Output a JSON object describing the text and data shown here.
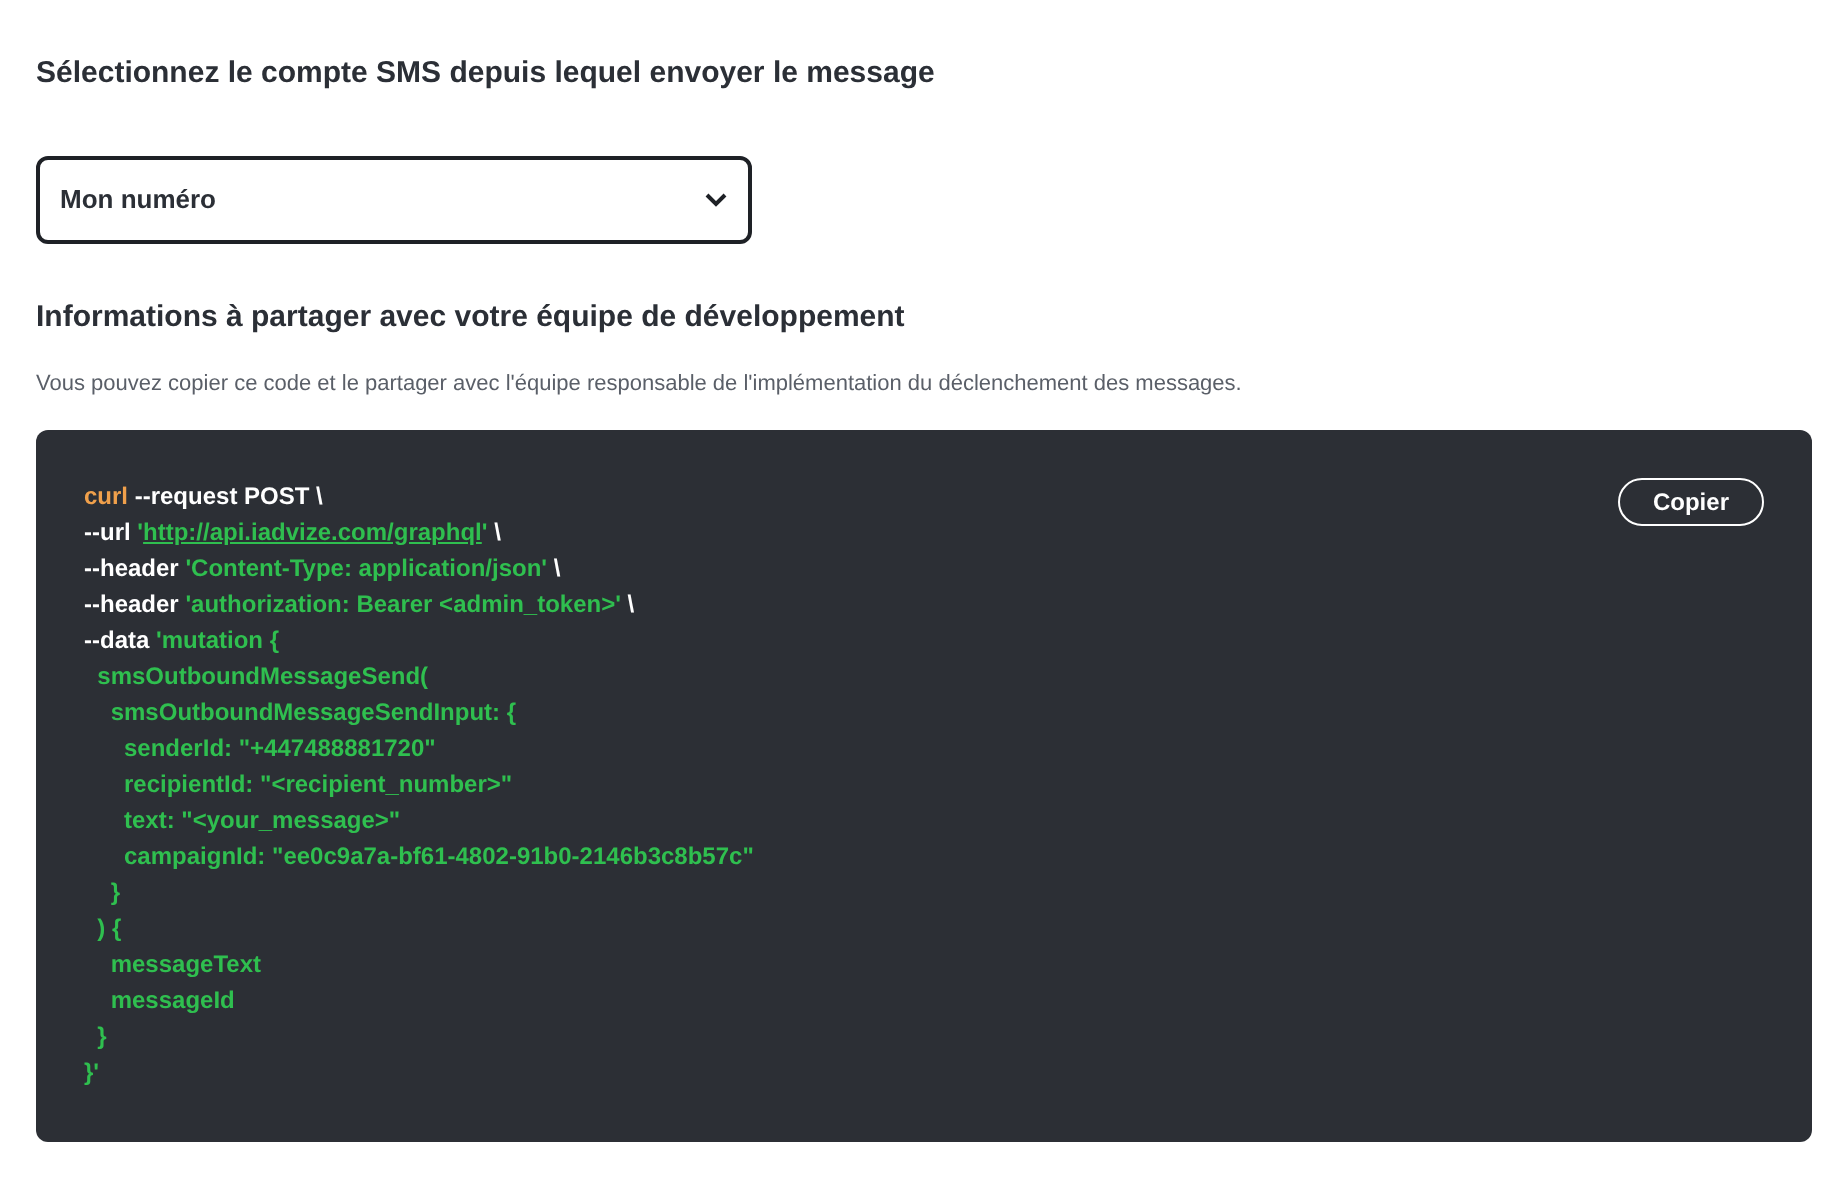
{
  "account_section": {
    "heading": "Sélectionnez le compte SMS depuis lequel envoyer le message",
    "select": {
      "value": "Mon numéro"
    }
  },
  "dev_section": {
    "heading": "Informations à partager avec votre équipe de développement",
    "description": "Vous pouvez copier ce code et le partager avec l'équipe responsable de l'implémentation du déclenchement des messages.",
    "code_block": {
      "copy_button": "Copier",
      "lines": [
        [
          {
            "kind": "keyword",
            "text": "curl"
          },
          {
            "kind": "plain",
            "text": " --request POST \\"
          }
        ],
        [
          {
            "kind": "plain",
            "text": "--url "
          },
          {
            "kind": "string",
            "text": "'"
          },
          {
            "kind": "link",
            "text": "http://api.iadvize.com/graphql"
          },
          {
            "kind": "string",
            "text": "'"
          },
          {
            "kind": "plain",
            "text": " \\"
          }
        ],
        [
          {
            "kind": "plain",
            "text": "--header "
          },
          {
            "kind": "string",
            "text": "'Content-Type: application/json'"
          },
          {
            "kind": "plain",
            "text": " \\"
          }
        ],
        [
          {
            "kind": "plain",
            "text": "--header "
          },
          {
            "kind": "string",
            "text": "'authorization: Bearer <admin_token>'"
          },
          {
            "kind": "plain",
            "text": " \\"
          }
        ],
        [
          {
            "kind": "plain",
            "text": "--data "
          },
          {
            "kind": "string",
            "text": "'mutation {"
          }
        ],
        [
          {
            "kind": "string",
            "text": "  smsOutboundMessageSend("
          }
        ],
        [
          {
            "kind": "string",
            "text": "    smsOutboundMessageSendInput: {"
          }
        ],
        [
          {
            "kind": "string",
            "text": "      senderId: \"+447488881720\""
          }
        ],
        [
          {
            "kind": "string",
            "text": "      recipientId: \"<recipient_number>\""
          }
        ],
        [
          {
            "kind": "string",
            "text": "      text: \"<your_message>\""
          }
        ],
        [
          {
            "kind": "string",
            "text": "      campaignId: \"ee0c9a7a-bf61-4802-91b0-2146b3c8b57c\""
          }
        ],
        [
          {
            "kind": "string",
            "text": "    }"
          }
        ],
        [
          {
            "kind": "string",
            "text": "  ) {"
          }
        ],
        [
          {
            "kind": "string",
            "text": "    messageText"
          }
        ],
        [
          {
            "kind": "string",
            "text": "    messageId"
          }
        ],
        [
          {
            "kind": "string",
            "text": "  }"
          }
        ],
        [
          {
            "kind": "string",
            "text": "}'"
          }
        ]
      ]
    }
  }
}
